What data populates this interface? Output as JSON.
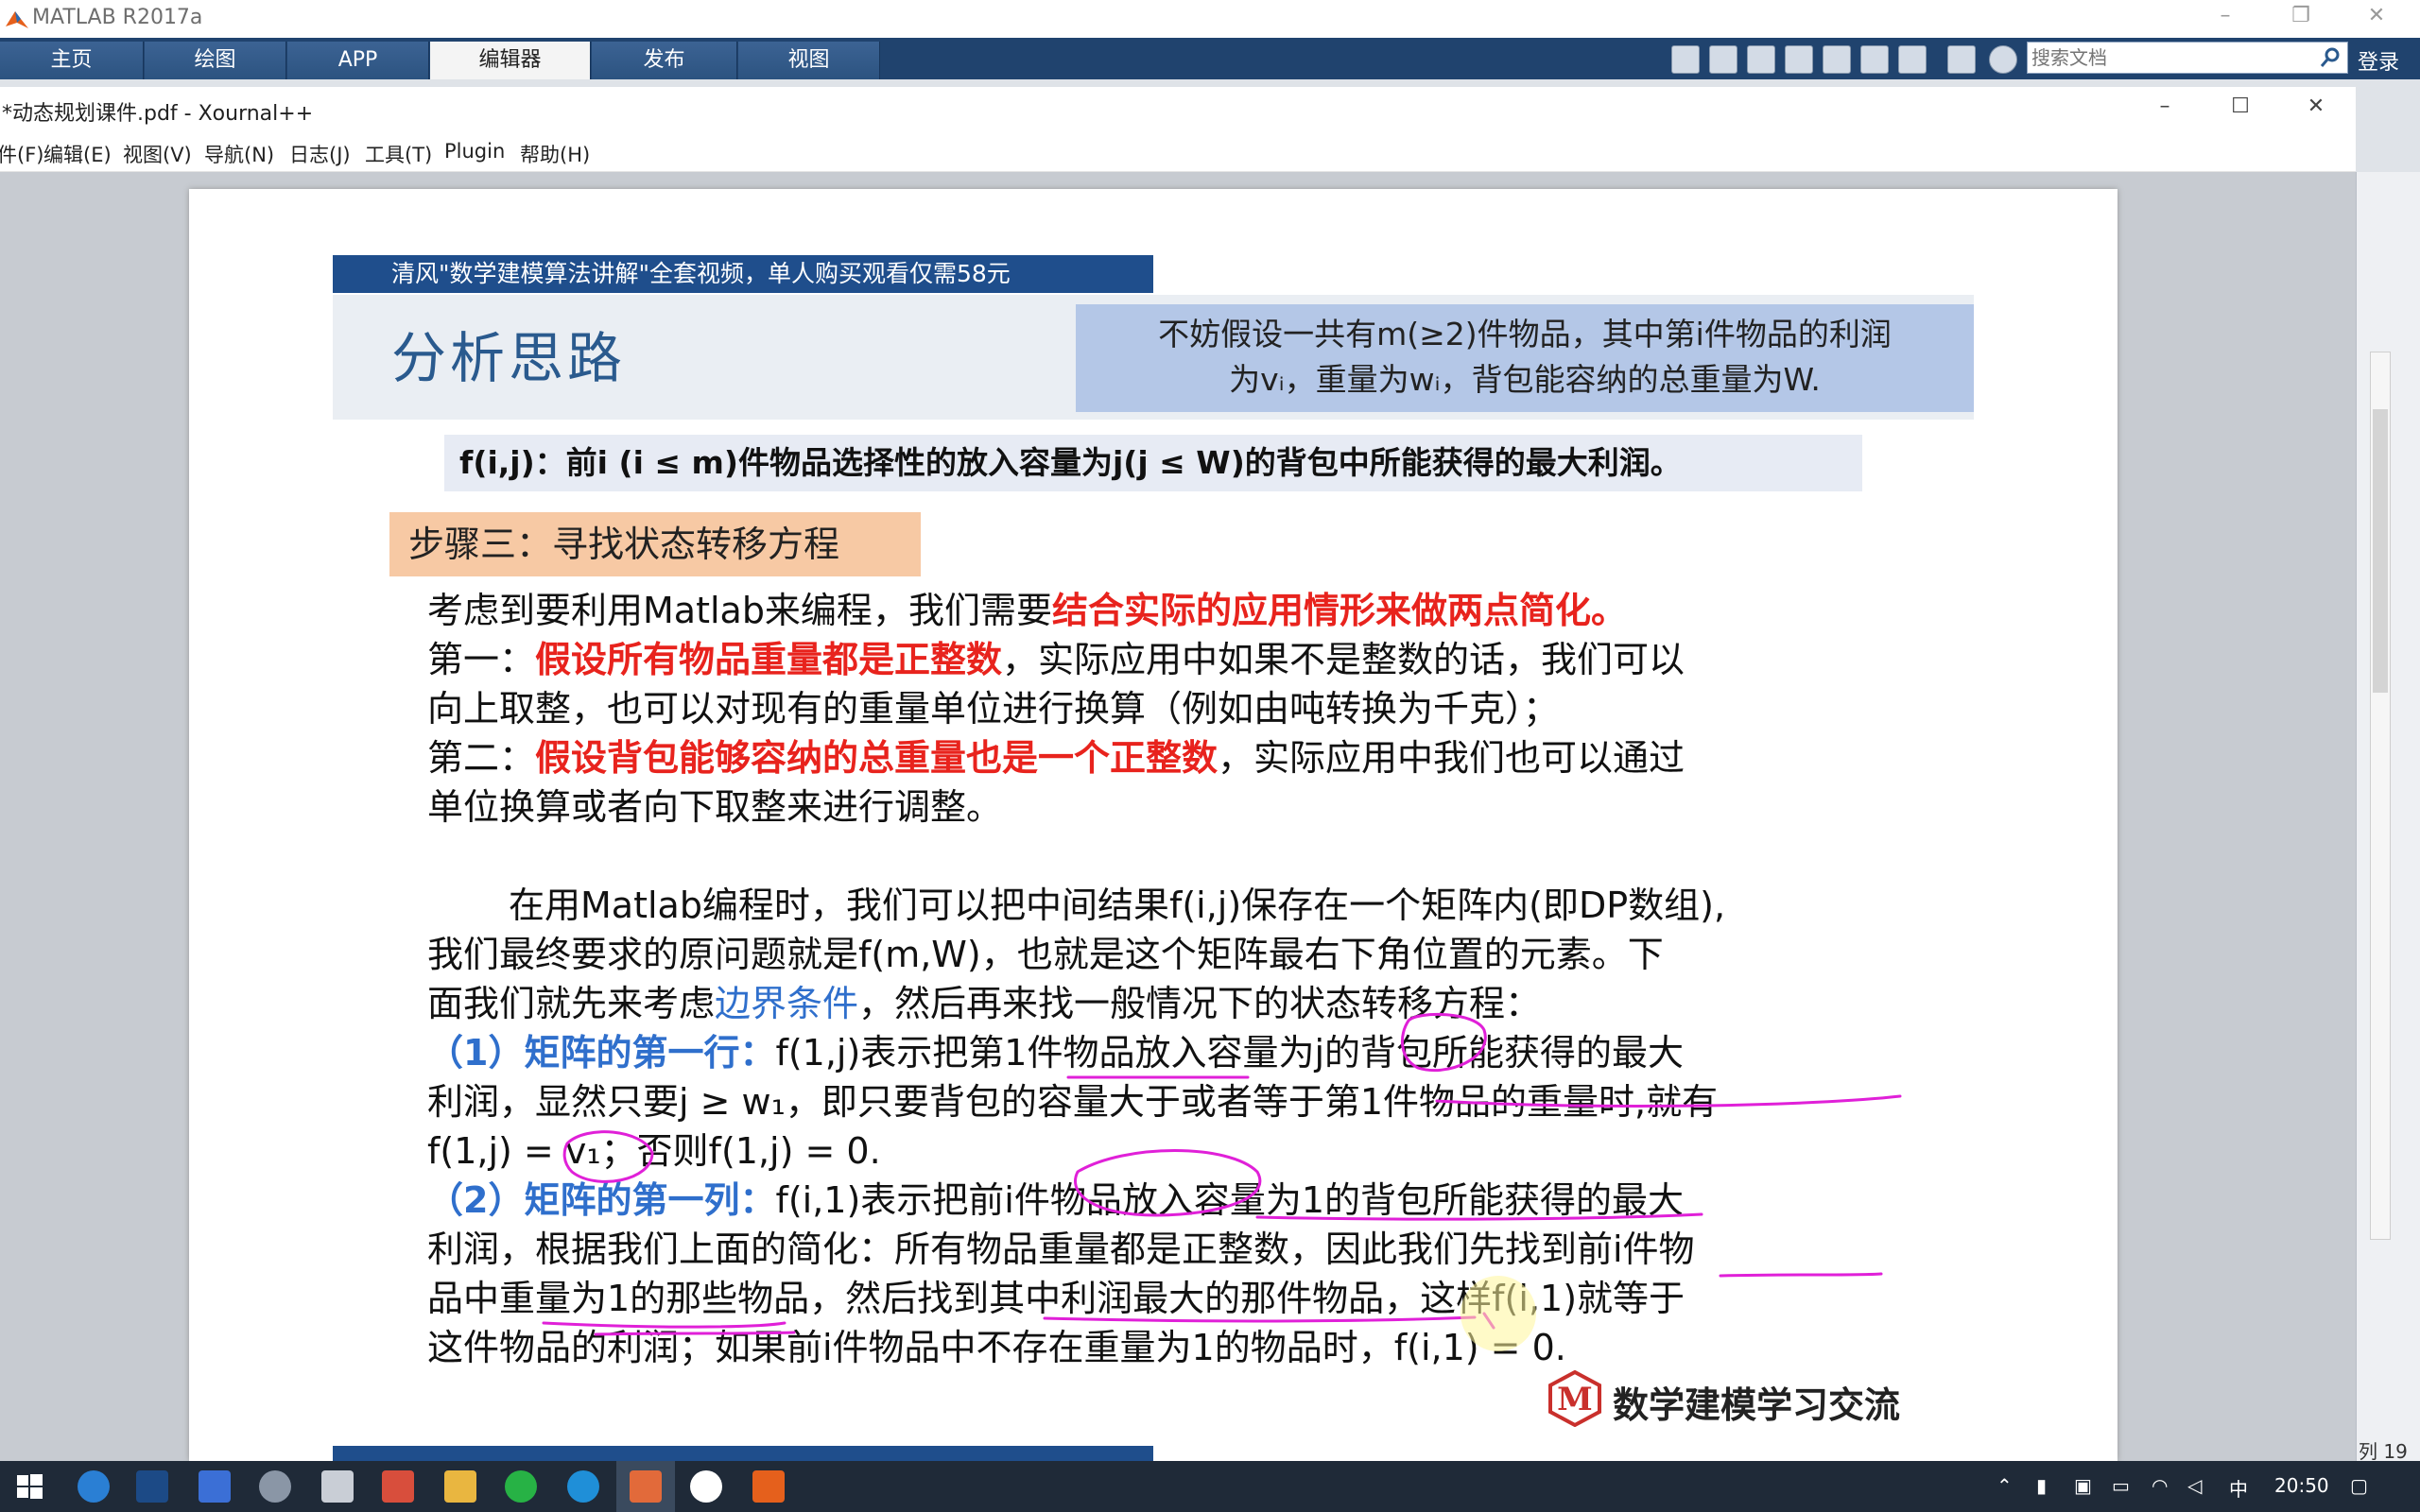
{
  "matlab": {
    "title": "MATLAB R2017a",
    "tabs": [
      "主页",
      "绘图",
      "APP",
      "编辑器",
      "发布",
      "视图"
    ],
    "active_tab": "编辑器",
    "search_placeholder": "搜索文档",
    "login_label": "登录"
  },
  "xournal": {
    "title": "*动态规划课件.pdf - Xournal++",
    "menu": [
      "文件(F)",
      "编辑(E)",
      "视图(V)",
      "导航(N)",
      "日志(J)",
      "工具(T)",
      "Plugin",
      "帮助(H)"
    ]
  },
  "slide": {
    "banner": "清风\"数学建模算法讲解\"全套视频，单人购买观看仅需58元",
    "heading": "分析思路",
    "definition_line1": "不妨假设一共有m(≥2)件物品，其中第i件物品的利润",
    "definition_line2": "为vᵢ，重量为wᵢ，背包能容纳的总重量为W.",
    "f_definition": "f(i,j)：前i (i ≤ m)件物品选择性的放入容量为j(j ≤ W)的背包中所能获得的最大利润。",
    "step_label": "步骤三：寻找状态转移方程",
    "p1_a": "考虑到要利用Matlab来编程，我们需要",
    "p1_b": "结合实际的应用情形来做两点简化。",
    "p2_a": "第一：",
    "p2_b": "假设所有物品重量都是正整数",
    "p2_c": "，实际应用中如果不是整数的话，我们可以",
    "p2_d": "向上取整，也可以对现有的重量单位进行换算（例如由吨转换为千克）；",
    "p3_a": "第二：",
    "p3_b": "假设背包能够容纳的总重量也是一个正整数",
    "p3_c": "，实际应用中我们也可以通过",
    "p3_d": "单位换算或者向下取整来进行调整。",
    "p4_line1": "在用Matlab编程时，我们可以把中间结果f(i,j)保存在一个矩阵内(即DP数组),",
    "p4_line2": "我们最终要求的原问题就是f(m,W)，也就是这个矩阵最右下角位置的元素。下",
    "p4_line3_a": "面我们就先来考虑",
    "p4_line3_b": "边界条件",
    "p4_line3_c": "，然后再来找一般情况下的状态转移方程：",
    "r1_label": "（1）矩阵的第一行：",
    "r1_line1": "f(1,j)表示把第1件物品放入容量为j的背包所能获得的最大",
    "r1_line2": "利润，显然只要j ≥ w₁，即只要背包的容量大于或者等于第1件物品的重量时,就有",
    "r1_line3": "f(1,j) = v₁；否则f(1,j) = 0.",
    "r2_label": "（2）矩阵的第一列：",
    "r2_line1": "f(i,1)表示把前i件物品放入容量为1的背包所能获得的最大",
    "r2_line2": "利润，根据我们上面的简化：所有物品重量都是正整数，因此我们先找到前i件物",
    "r2_line3": "品中重量为1的那些物品，然后找到其中利润最大的那件物品，这样f(i,1)就等于",
    "r2_line4": "这件物品的利润；如果前i件物品中不存在重量为1的物品时，f(i,1) = 0.",
    "logo_letter": "M",
    "logo_text": "数学建模学习交流"
  },
  "side_panel": {
    "label": "列 19"
  },
  "taskbar": {
    "ime": "中",
    "time": "20:50"
  },
  "colors": {
    "ribbon": "#20436e",
    "banner": "#1f4e8c",
    "emphasis_red": "#e8231d",
    "link_blue": "#2f6fcc",
    "ink": "#e020d8"
  }
}
